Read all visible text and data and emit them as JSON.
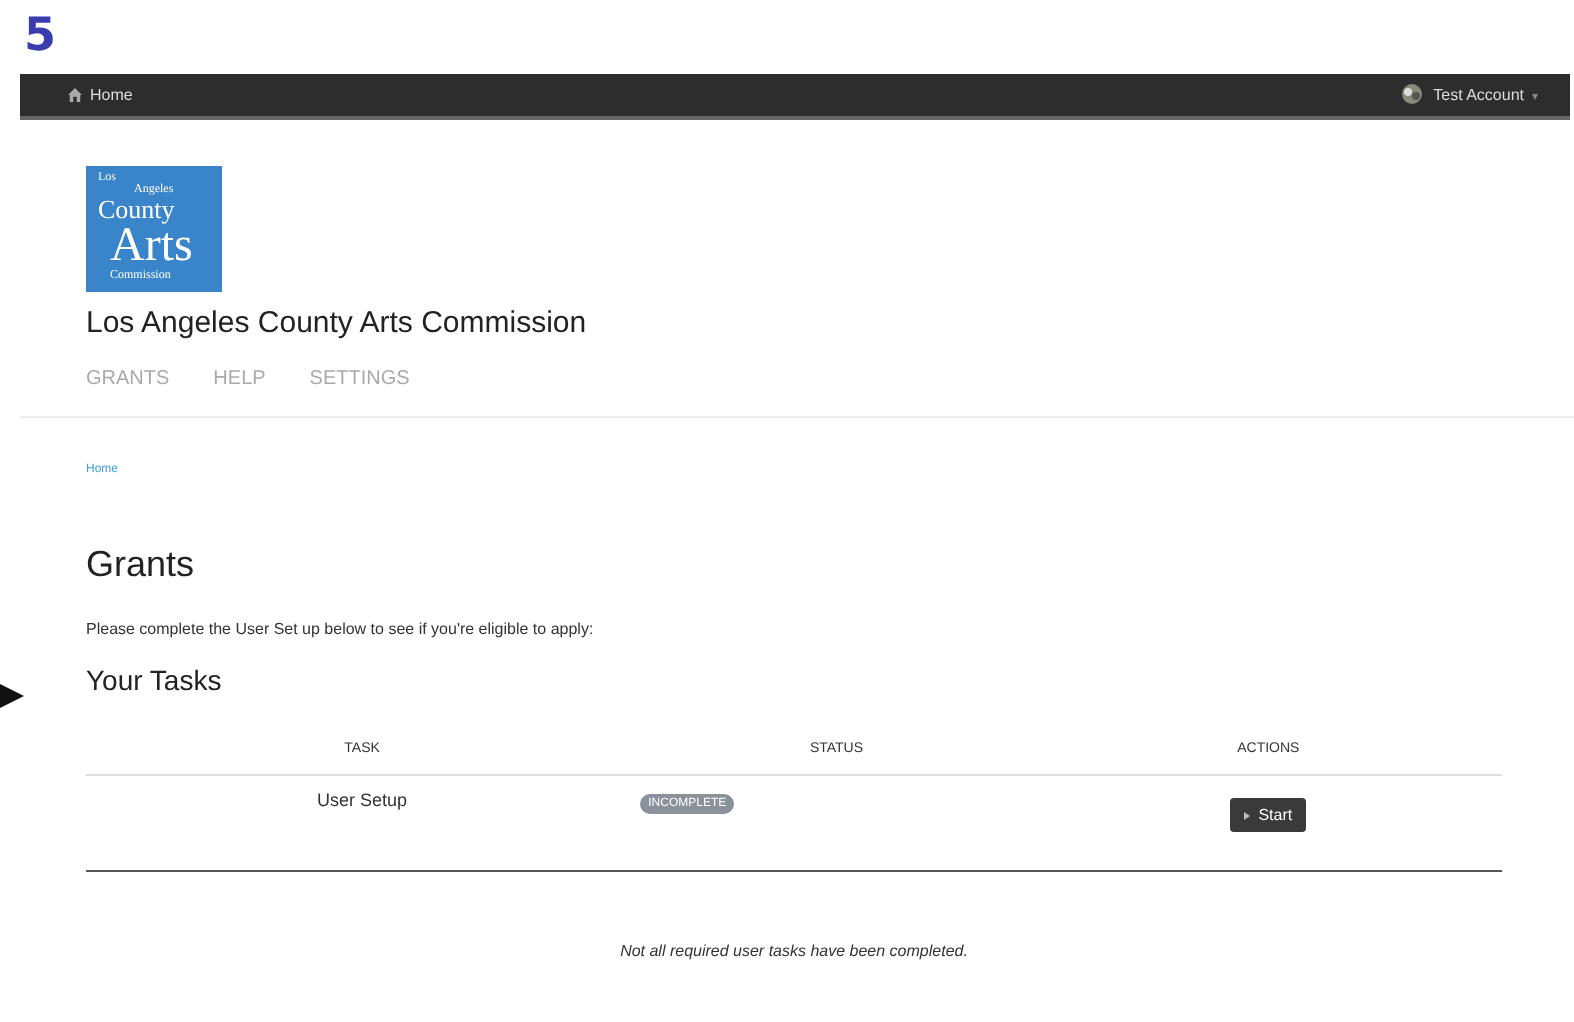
{
  "step_number": "5",
  "navbar": {
    "home": "Home",
    "account": "Test Account",
    "account_caret": "▾"
  },
  "logo": {
    "lines": [
      "Los",
      "Angeles",
      "County",
      "Arts",
      "Commission"
    ]
  },
  "organization": "Los Angeles County Arts Commission",
  "menu": [
    {
      "label": "GRANTS"
    },
    {
      "label": "HELP"
    },
    {
      "label": "SETTINGS"
    }
  ],
  "breadcrumb": "Home",
  "page_title": "Grants",
  "intro": "Please complete the User Set up below to see if you're eligible to apply:",
  "section_title": "Your Tasks",
  "table": {
    "columns": [
      "TASK",
      "STATUS",
      "ACTIONS"
    ],
    "rows": [
      {
        "task": "User Setup",
        "status": "INCOMPLETE",
        "action": "Start"
      }
    ]
  },
  "note": "Not all required user tasks have been completed."
}
